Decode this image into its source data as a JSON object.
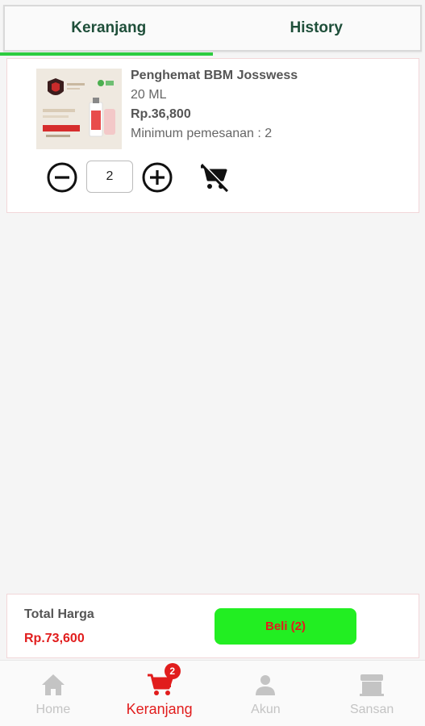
{
  "tabs": [
    {
      "label": "Keranjang",
      "active": true
    },
    {
      "label": "History",
      "active": false
    }
  ],
  "cart_items": [
    {
      "name": "Penghemat BBM Josswess",
      "volume": "20 ML",
      "price": "Rp.36,800",
      "min_order": "Minimum pemesanan : 2",
      "quantity": "2"
    }
  ],
  "summary": {
    "total_label": "Total Harga",
    "total_value": "Rp.73,600",
    "buy_label": "Beli (2)"
  },
  "bottom_nav": {
    "items": [
      {
        "label": "Home",
        "icon": "home-icon"
      },
      {
        "label": "Keranjang",
        "icon": "cart-icon",
        "badge": "2",
        "active": true
      },
      {
        "label": "Akun",
        "icon": "person-icon"
      },
      {
        "label": "Sansan",
        "icon": "store-icon"
      }
    ]
  },
  "colors": {
    "accent_green": "#2ecc40",
    "buy_button": "#22ee22",
    "active_red": "#e11d1d",
    "inactive_nav": "#c4c4c4",
    "tab_text": "#1f4f3a"
  }
}
